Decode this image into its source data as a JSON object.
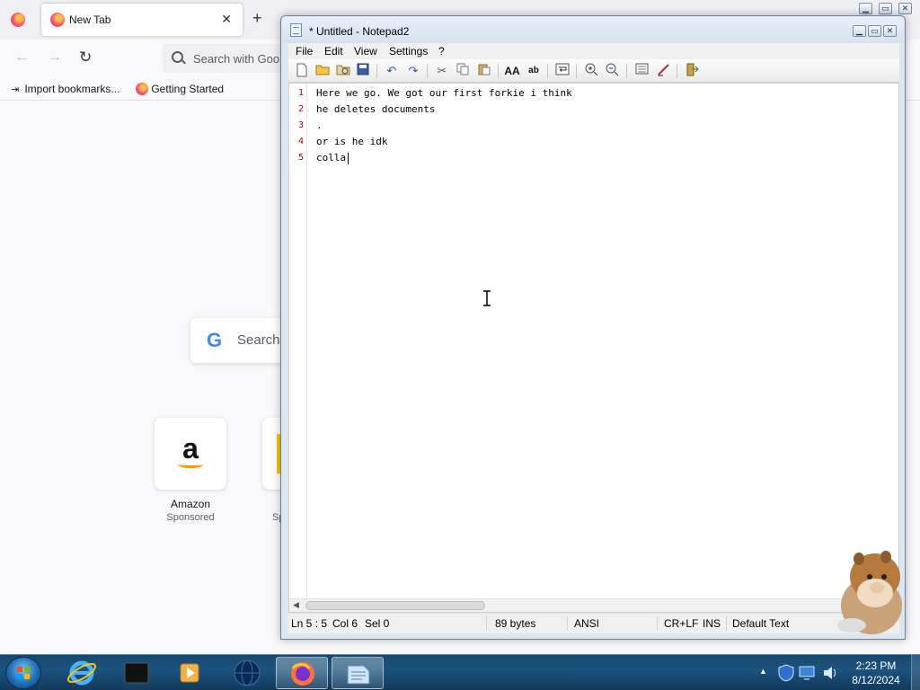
{
  "firefox": {
    "tab_title": "New Tab",
    "tab_close": "✕",
    "new_tab": "+",
    "nav": {
      "back": "←",
      "forward": "→",
      "reload": "↻"
    },
    "urlbar_placeholder": "Search with Goo",
    "bookmarks": [
      "Import bookmarks...",
      "Getting Started"
    ],
    "google_search_placeholder": "Search",
    "tile": {
      "name": "Amazon",
      "sponsored": "Sponsored",
      "logo": "a",
      "partial_sponsored": "Sp"
    }
  },
  "notepad": {
    "title": "* Untitled - Notepad2",
    "caption_buttons": [
      "▁",
      "▭",
      "✕"
    ],
    "menu": [
      "File",
      "Edit",
      "View",
      "Settings",
      "?"
    ],
    "toolbar_icons": [
      "new-file-icon",
      "open-file-icon",
      "browse-icon",
      "save-icon",
      "undo-icon",
      "redo-icon",
      "cut-icon",
      "copy-icon",
      "paste-icon",
      "find-icon",
      "replace-icon",
      "word-wrap-icon",
      "zoom-in-icon",
      "zoom-out-icon",
      "scheme-icon",
      "customize-icon",
      "exit-icon"
    ],
    "lines": [
      {
        "number": "1",
        "text": "Here we go. We got our first forkie i think"
      },
      {
        "number": "2",
        "text": "he deletes documents"
      },
      {
        "number": "3",
        "text": "."
      },
      {
        "number": "4",
        "text": "or is he idk"
      },
      {
        "number": "5",
        "text": "colla"
      }
    ],
    "status": {
      "position": "Ln 5 : 5",
      "column": "Col 6",
      "selection": "Sel 0",
      "size": "89 bytes",
      "encoding": "ANSI",
      "line_endings": "CR+LF",
      "mode": "INS",
      "scheme": "Default Text"
    }
  },
  "taskbar": {
    "apps": [
      "internet-explorer-icon",
      "terminal-icon",
      "media-player-icon",
      "globe-icon",
      "firefox-icon",
      "notepad-icon"
    ],
    "tray_arrow": "▲",
    "clock_time": "2:23 PM",
    "clock_date": "8/12/2024"
  },
  "colors": {
    "accent": "#1b547f",
    "line_number": "#c00000",
    "firefox_bg": "#f9f9fb"
  }
}
